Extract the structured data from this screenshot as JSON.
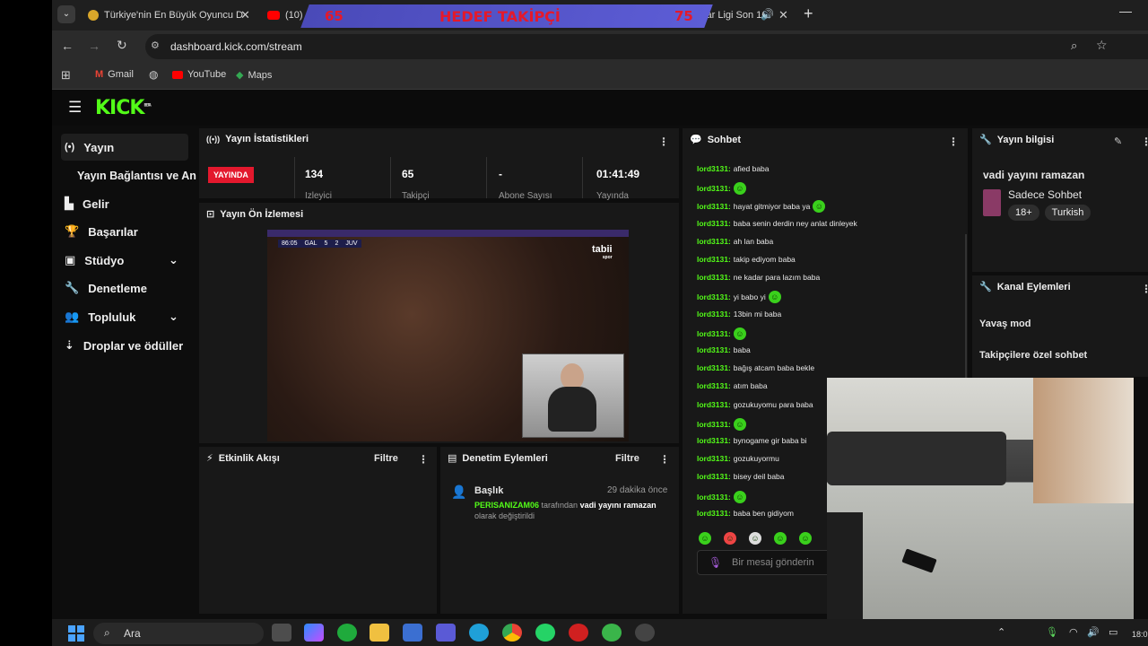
{
  "browser": {
    "tabs": [
      {
        "title": "Türkiye'nin En Büyük Oyuncu D"
      },
      {
        "title": "(10)"
      },
      {
        "title": "şampiyonlar Ligi Son 16"
      }
    ],
    "overlay": {
      "left_number": "65",
      "center_text": "HEDEF TAKİPÇİ",
      "right_number": "75"
    },
    "url": "dashboard.kick.com/stream",
    "bookmarks": [
      "Gmail",
      "YouTube",
      "Maps"
    ]
  },
  "kick": {
    "logo": "KICK",
    "logo_badge": "BETA",
    "sidebar": [
      {
        "label": "Yayın",
        "icon": "broadcast-icon"
      },
      {
        "label": "Yayın Bağlantısı ve An"
      },
      {
        "label": "Gelir",
        "icon": "chart-icon"
      },
      {
        "label": "Başarılar",
        "icon": "trophy-icon"
      },
      {
        "label": "Stüdyo",
        "icon": "studio-icon"
      },
      {
        "label": "Denetleme",
        "icon": "wrench-icon"
      },
      {
        "label": "Topluluk",
        "icon": "people-icon"
      },
      {
        "label": "Droplar ve ödüller",
        "icon": "drops-icon"
      }
    ],
    "stats": {
      "title": "Yayın İstatistikleri",
      "live_badge": "YAYINDA",
      "items": [
        {
          "value": "134",
          "label": "İzleyici"
        },
        {
          "value": "65",
          "label": "Takipçi"
        },
        {
          "value": "-",
          "label": "Abone Sayısı"
        },
        {
          "value": "01:41:49",
          "label": "Yayında"
        }
      ]
    },
    "preview": {
      "title": "Yayın Ön İzlemesi",
      "scoreboard": {
        "time": "86:05",
        "home": "GAL",
        "home_score": "5",
        "away_score": "2",
        "away": "JUV"
      },
      "broadcaster": "tabii",
      "broadcaster_sub": "spor"
    },
    "activity": {
      "title": "Etkinlik Akışı",
      "filter": "Filtre"
    },
    "moderation": {
      "title": "Denetim Eylemleri",
      "filter": "Filtre",
      "entry": {
        "heading": "Başlık",
        "time": "29 dakika önce",
        "user": "PERISANIZAM06",
        "by": "tarafından",
        "value": "vadi yayını ramazan",
        "suffix": "olarak değiştirildi"
      }
    },
    "chat": {
      "title": "Sohbet",
      "user": "lord3131",
      "messages": [
        {
          "text": "afied baba",
          "emote": false
        },
        {
          "text": "",
          "emote": true
        },
        {
          "text": "hayat gitmiyor baba ya",
          "emote": true
        },
        {
          "text": "baba senin derdin ney anlat dinleyek",
          "emote": false
        },
        {
          "text": "ah lan baba",
          "emote": false
        },
        {
          "text": "takip ediyom baba",
          "emote": false
        },
        {
          "text": "ne kadar para lazım baba",
          "emote": false
        },
        {
          "text": "yi babo yi",
          "emote": true
        },
        {
          "text": "13bin mi baba",
          "emote": false
        },
        {
          "text": "",
          "emote": true
        },
        {
          "text": "baba",
          "emote": false
        },
        {
          "text": "bağış atcam baba bekle",
          "emote": false
        },
        {
          "text": "atım baba",
          "emote": false
        },
        {
          "text": "gozukuyomu para baba",
          "emote": false
        },
        {
          "text": "",
          "emote": true
        },
        {
          "text": "bynogame gir baba bi",
          "emote": false
        },
        {
          "text": "gozukuyormu",
          "emote": false
        },
        {
          "text": "bisey deil baba",
          "emote": false
        },
        {
          "text": "",
          "emote": true
        },
        {
          "text": "baba ben gidiyom",
          "emote": false
        }
      ],
      "input_placeholder": "Bir mesaj gönderin"
    },
    "stream_info": {
      "title": "Yayın bilgisi",
      "stream_title": "vadi yayını ramazan",
      "category": "Sadece Sohbet",
      "tags": [
        "18+",
        "Turkish"
      ]
    },
    "channel_actions": {
      "title": "Kanal Eylemleri",
      "items": [
        "Yavaş mod",
        "Takipçilere özel sohbet"
      ]
    }
  },
  "taskbar": {
    "search": "Ara",
    "clock": "18:0"
  },
  "colors": {
    "kick_green": "#53fc18",
    "live_red": "#e3182d",
    "overlay_blue": "#5555cc",
    "overlay_red": "#e4192b"
  }
}
